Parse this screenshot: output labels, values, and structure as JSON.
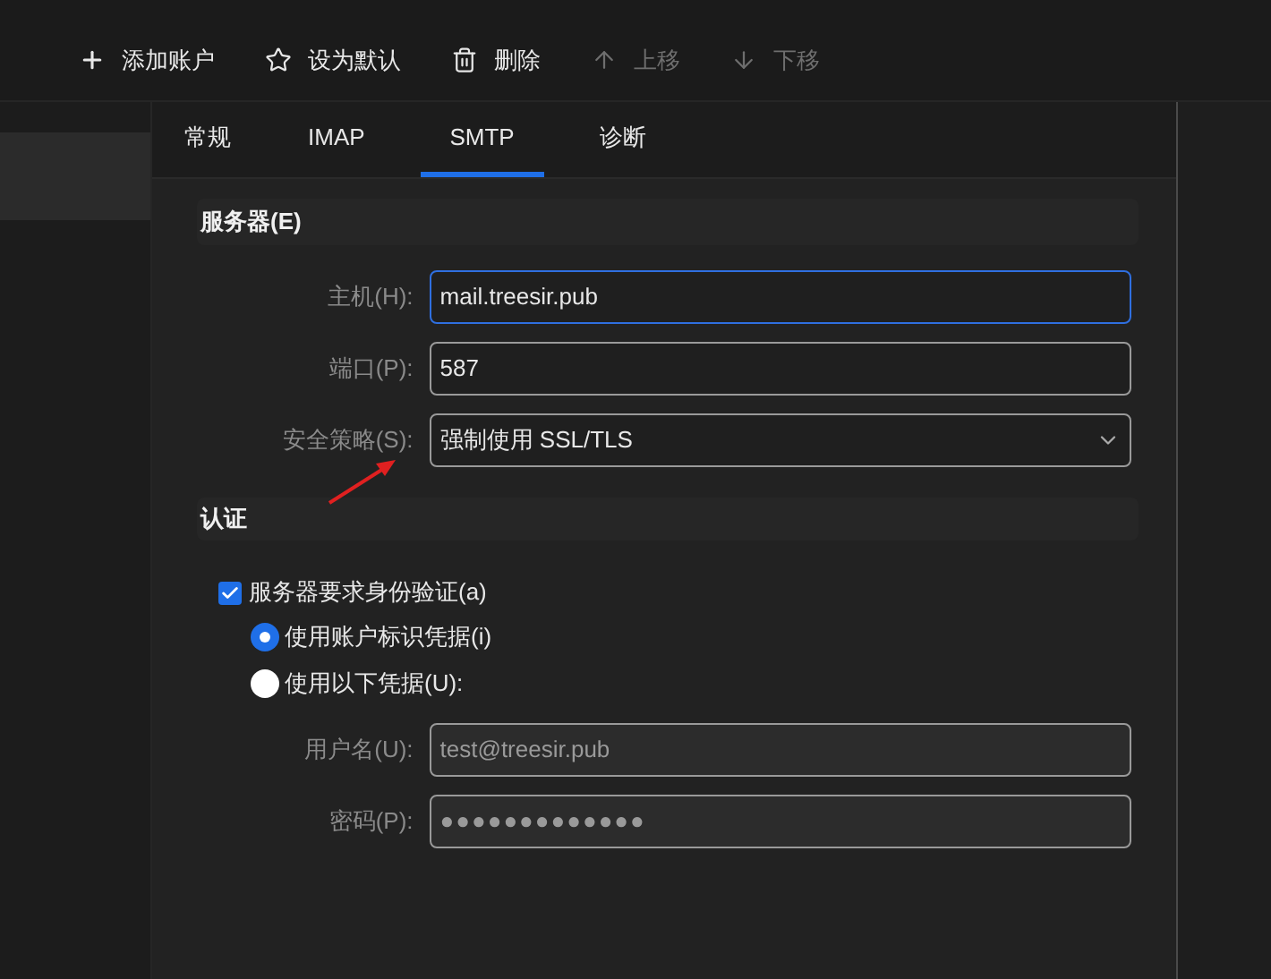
{
  "toolbar": [
    {
      "kind": "add",
      "label": "添加账户",
      "disabled": false
    },
    {
      "kind": "star",
      "label": "设为默认",
      "disabled": false
    },
    {
      "kind": "delete",
      "label": "删除",
      "disabled": false
    },
    {
      "kind": "up",
      "label": "上移",
      "disabled": true
    },
    {
      "kind": "down",
      "label": "下移",
      "disabled": true
    }
  ],
  "sidebar": {
    "items": [
      {
        "selected": true
      }
    ]
  },
  "tabs": [
    {
      "label": "常规",
      "selected": false
    },
    {
      "label": "IMAP",
      "selected": false
    },
    {
      "label": "SMTP",
      "selected": true
    },
    {
      "label": "诊断",
      "selected": false
    }
  ],
  "server_section": {
    "title": "服务器(E)",
    "fields": [
      {
        "kind": "text",
        "label": "主机(H):",
        "value": "mail.treesir.pub",
        "focused": true,
        "disabled": false
      },
      {
        "kind": "text",
        "label": "端口(P):",
        "value": "587",
        "focused": false,
        "disabled": false
      },
      {
        "kind": "select",
        "label": "安全策略(S):",
        "value": "强制使用 SSL/TLS",
        "focused": false,
        "disabled": false
      }
    ]
  },
  "auth_section": {
    "title": "认证",
    "require_auth": {
      "label": "服务器要求身份验证(a)",
      "checked": true
    },
    "options": [
      {
        "label": "使用账户标识凭据(i)",
        "selected": true
      },
      {
        "label": "使用以下凭据(U):",
        "selected": false
      }
    ],
    "fields": [
      {
        "kind": "text",
        "label": "用户名(U):",
        "value": "test@treesir.pub",
        "focused": false,
        "disabled": true
      },
      {
        "kind": "password",
        "label": "密码(P):",
        "value": "●●●●●●●●●●●●●",
        "focused": false,
        "disabled": true
      }
    ]
  }
}
